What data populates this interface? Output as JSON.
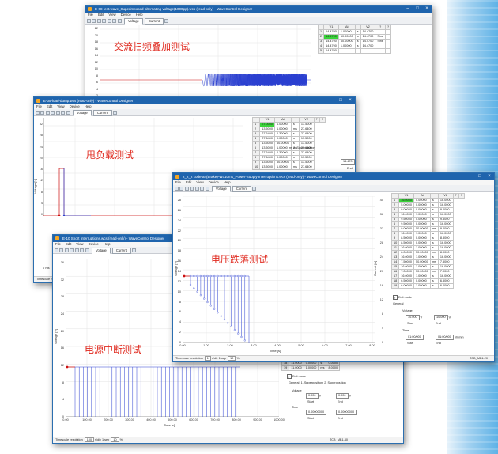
{
  "windows": {
    "w1": {
      "title": "E-08-test.wave_Superimposed-alternating-voltage(1000pp).wcs (read-only) - WaveControl Designer",
      "menu": [
        "File",
        "Edit",
        "View",
        "Device",
        "Help"
      ],
      "tabs": [
        "Voltage",
        "Current"
      ],
      "label": "交流扫频叠加测试",
      "yticks": [
        "22",
        "20",
        "18",
        "16",
        "14",
        "12",
        "10",
        "8",
        "6",
        "4",
        "2"
      ],
      "table": {
        "headers": [
          "",
          "V1",
          "Δt",
          "",
          "V2",
          "?",
          "?"
        ],
        "rows": [
          [
            "1",
            "14.4700",
            "1.00000",
            "s",
            "14.4700",
            "",
            ""
          ],
          [
            "2",
            "14.4700",
            "60.00000",
            "s",
            "14.4700",
            "Sine",
            ""
          ],
          [
            "3",
            "14.4700",
            "60.00000",
            "s",
            "14.4700",
            "Sine",
            ""
          ],
          [
            "4",
            "14.4700",
            "1.00000",
            "s",
            "14.4700",
            "",
            ""
          ],
          [
            "5",
            "14.4700",
            "",
            "",
            "",
            "",
            ""
          ]
        ]
      }
    },
    "w2": {
      "title": "E-05-load-dump.wcs (read-only) - WaveControl Designer",
      "menu": [
        "File",
        "Edit",
        "View",
        "Device",
        "Help"
      ],
      "tabs": [
        "Voltage",
        "Current"
      ],
      "label": "甩负载测试",
      "ylabel": "Voltage [V]",
      "yticks": [
        "32",
        "28",
        "24",
        "20",
        "16",
        "12",
        "8",
        "4",
        "0"
      ],
      "xtick0": "0 ms",
      "status": "Timescale re",
      "sidetext": "ms  2. Superposition",
      "sideval": "14.470",
      "sideend": "End",
      "table": {
        "headers": [
          "",
          "V1",
          "Δt",
          "",
          "V2",
          "?",
          "?"
        ],
        "rows": [
          [
            "1",
            "27.0000",
            "1.00000",
            "s",
            "13.5000"
          ],
          [
            "2",
            "13.5000",
            "1.00000",
            "ms",
            "27.6400"
          ],
          [
            "3",
            "27.6400",
            "0.30000",
            "s",
            "27.6400"
          ],
          [
            "4",
            "27.6400",
            "0.00000",
            "s",
            "13.5000"
          ],
          [
            "5",
            "13.5000",
            "60.00000",
            "s",
            "13.5000"
          ],
          [
            "6",
            "13.5000",
            "1.00000",
            "ms",
            "27.6400"
          ],
          [
            "7",
            "27.6400",
            "0.30000",
            "s",
            "27.6400"
          ],
          [
            "8",
            "27.6400",
            "0.00000",
            "s",
            "13.5000"
          ],
          [
            "9",
            "13.5000",
            "60.00000",
            "s",
            "13.5000"
          ],
          [
            "10",
            "13.5000",
            "1.00000",
            "ms",
            "27.6400"
          ]
        ]
      }
    },
    "w3": {
      "title": "E-10 Short Interruptions.wcs (read-only) - WaveControl Designer",
      "menu": [
        "File",
        "Edit",
        "View",
        "Device",
        "Help"
      ],
      "tabs": [
        "Voltage",
        "Current"
      ],
      "label": "电源中断测试",
      "ylabel": "Voltage [V]",
      "xlabel": "Time [s]",
      "yticks": [
        "36",
        "32",
        "28",
        "24",
        "20",
        "16",
        "12",
        "8",
        "4",
        "0"
      ],
      "xticks": [
        "0.00",
        "100.00",
        "200.00",
        "300.00",
        "400.00",
        "500.00",
        "600.00",
        "700.00",
        "800.00",
        "900.00",
        "1000.00"
      ],
      "status": {
        "label": "Timescale resolution",
        "value": "100",
        "unit": "s/div",
        "step_label": "1 sep",
        "step_value": "10",
        "pct": "%"
      },
      "table": {
        "rows": [
          [
            "18",
            "11.0000",
            "0.00000",
            "s",
            "0.0000"
          ],
          [
            "19",
            "11.0000",
            "1.00000",
            "ms",
            "8.0000"
          ]
        ]
      },
      "edit_mode": "Edit mode",
      "sidetabs": [
        "General",
        "1. Superposition",
        "2. Superposition"
      ],
      "voltage_label": "Voltage",
      "voltage_start": "0.000",
      "voltage_end": "0.000",
      "time_label": "Time",
      "time_start": "0.00000000",
      "time_end": "0.00000000",
      "start_label": "Start",
      "end_label": "End",
      "serial": "TCB_MB1-40"
    },
    "w4": {
      "title": "2_2_2 code-a4(Brake)-Wt 10ms_Power-Supply-Interruptions.wcs (read-only) - WaveControl Designer",
      "menu": [
        "File",
        "Edit",
        "View",
        "Device",
        "Help"
      ],
      "tabs": [
        "Voltage",
        "Current"
      ],
      "label": "电压跌落测试",
      "ylabel": "Voltage [V]",
      "ylabel2": "Current [A]",
      "xlabel": "Time [s]",
      "yticks": [
        "28",
        "26",
        "24",
        "22",
        "20",
        "18",
        "16",
        "14",
        "12",
        "10",
        "8",
        "6",
        "4",
        "2",
        "0"
      ],
      "yticks2": [
        "40",
        "36",
        "32",
        "28",
        "24",
        "20",
        "16",
        "12",
        "8",
        "4",
        "0"
      ],
      "xticks": [
        "0.00",
        "1.00",
        "2.00",
        "3.00",
        "4.00",
        "5.00",
        "6.00",
        "7.00",
        "8.00"
      ],
      "status": {
        "label": "Timescale resolution",
        "value": "1",
        "unit": "s/div",
        "step_label": "1 sep",
        "step_value": "10",
        "pct": "%"
      },
      "edit_mode": "Edit mode",
      "general": "General",
      "voltage_label": "Voltage",
      "voltage_start": "10.000",
      "voltage_end": "10.000",
      "time_label": "Time",
      "time_start": "01:00/000",
      "time_end": "01:00/000",
      "time_unit": "hh:mm",
      "start_label": "Start",
      "end_label": "End",
      "serial": "TCB_MB1-20",
      "table": {
        "headers": [
          "",
          "V1",
          "Δt",
          "",
          "V2",
          "?",
          "?"
        ],
        "rows": [
          [
            "1",
            "16.0000",
            "0.00000",
            "s",
            "16.0000"
          ],
          [
            "2",
            "5.00000",
            "0.00000",
            "s",
            "16.0000"
          ],
          [
            "3",
            "9.00000",
            "0.00000",
            "s",
            "9.0000"
          ],
          [
            "4",
            "16.0000",
            "1.00000",
            "s",
            "16.0000"
          ],
          [
            "5",
            "9.50000",
            "0.00000",
            "s",
            "9.5000"
          ],
          [
            "6",
            "9.50000",
            "0.00000",
            "s",
            "16.0000"
          ],
          [
            "7",
            "9.00000",
            "50.00000",
            "ms",
            "9.0000"
          ],
          [
            "8",
            "16.0000",
            "1.00000",
            "s",
            "16.0000"
          ],
          [
            "9",
            "8.50000",
            "0.00000",
            "s",
            "8.5000"
          ],
          [
            "10",
            "8.50000",
            "0.00000",
            "s",
            "16.0000"
          ],
          [
            "11",
            "16.0000",
            "1.00000",
            "s",
            "16.0000"
          ],
          [
            "12",
            "8.00000",
            "50.00000",
            "ms",
            "8.0000"
          ],
          [
            "13",
            "16.0000",
            "1.00000",
            "s",
            "16.0000"
          ],
          [
            "14",
            "7.50000",
            "50.00000",
            "ms",
            "7.5000"
          ],
          [
            "15",
            "16.0000",
            "1.00000",
            "s",
            "16.0000"
          ],
          [
            "16",
            "7.00000",
            "50.00000",
            "ms",
            "7.0000"
          ],
          [
            "17",
            "16.0000",
            "1.00000",
            "s",
            "16.0000"
          ],
          [
            "18",
            "6.50000",
            "0.00000",
            "s",
            "6.5000"
          ],
          [
            "19",
            "6.00000",
            "1.00000",
            "s",
            "6.0000"
          ]
        ]
      }
    }
  },
  "colors": {
    "titlebar": "#1f64ad",
    "trace": "#2a3fd0",
    "marker": "#cc1010",
    "label": "#e02a1f",
    "grid": "#e3e3e3"
  }
}
